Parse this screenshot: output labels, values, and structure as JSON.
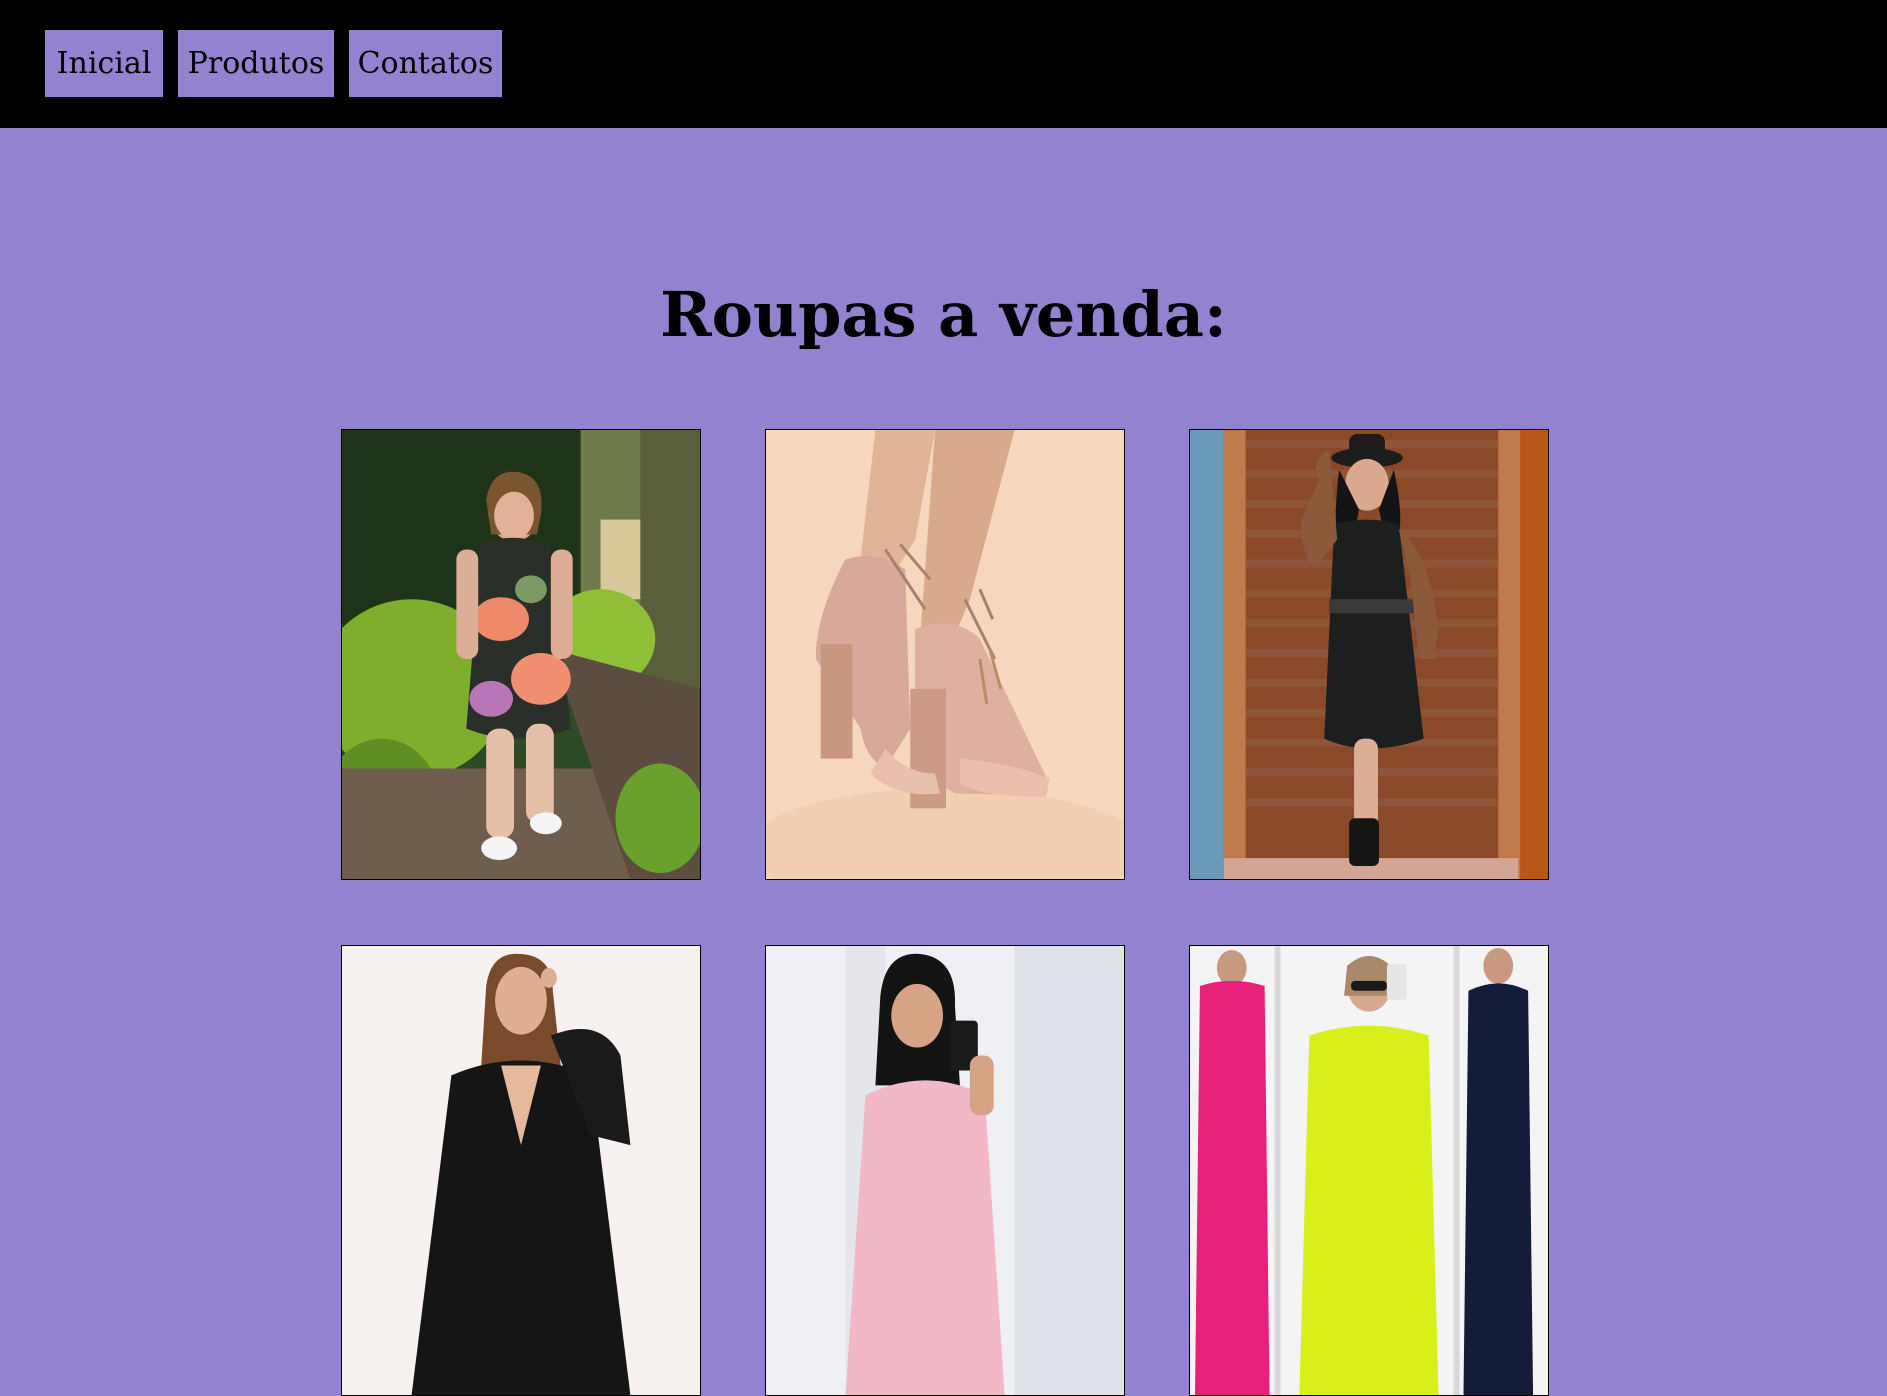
{
  "nav": {
    "items": [
      {
        "label": "Inicial"
      },
      {
        "label": "Produtos"
      },
      {
        "label": "Contatos"
      }
    ]
  },
  "main": {
    "heading": "Roupas a venda:"
  },
  "colors": {
    "background": "#9282cf",
    "topbar": "#000000",
    "nav_button": "#9282cf"
  },
  "products": [
    {
      "image": "woman-floral-dress-garden"
    },
    {
      "image": "nude-block-heel-sandals"
    },
    {
      "image": "woman-black-shirt-dress-hat"
    },
    {
      "image": "woman-black-wrap-top"
    },
    {
      "image": "woman-pink-top-selfie"
    },
    {
      "image": "three-women-colored-dresses"
    }
  ]
}
